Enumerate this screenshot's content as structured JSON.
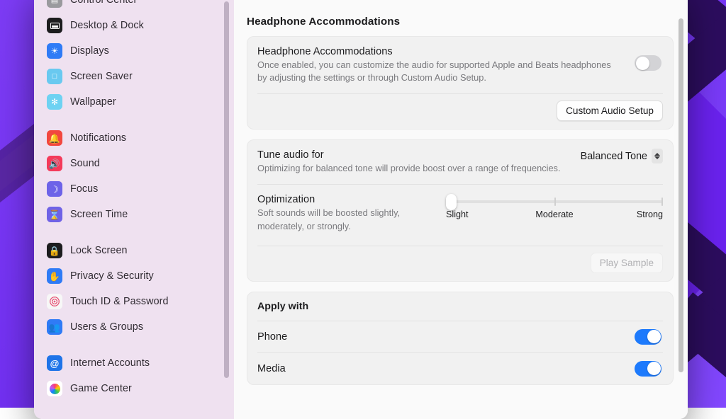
{
  "sidebar": {
    "items": [
      {
        "label": "Control Center",
        "icon": "control-center-icon",
        "color": "#9a9a9e",
        "glyph": "▤",
        "partial": true
      },
      {
        "label": "Desktop & Dock",
        "icon": "desktop-dock-icon",
        "color": "#1c1c1e",
        "glyph": "bar"
      },
      {
        "label": "Displays",
        "icon": "displays-icon",
        "color": "#2f7bf6",
        "glyph": "☀"
      },
      {
        "label": "Screen Saver",
        "icon": "screen-saver-icon",
        "color": "#69c9f0",
        "glyph": "□"
      },
      {
        "label": "Wallpaper",
        "icon": "wallpaper-icon",
        "color": "#6ed2f2",
        "glyph": "✻"
      },
      {
        "label": "__GAP__",
        "icon": "group-separator",
        "color": "",
        "glyph": ""
      },
      {
        "label": "Notifications",
        "icon": "notifications-icon",
        "color": "#f2473f",
        "glyph": "🔔"
      },
      {
        "label": "Sound",
        "icon": "sound-icon",
        "color": "#f43a5a",
        "glyph": "🔊"
      },
      {
        "label": "Focus",
        "icon": "focus-icon",
        "color": "#6d63e8",
        "glyph": "☽"
      },
      {
        "label": "Screen Time",
        "icon": "screen-time-icon",
        "color": "#6f62e6",
        "glyph": "⌛"
      },
      {
        "label": "__GAP__",
        "icon": "group-separator",
        "color": "",
        "glyph": ""
      },
      {
        "label": "Lock Screen",
        "icon": "lock-screen-icon",
        "color": "#1c1c1e",
        "glyph": "🔒"
      },
      {
        "label": "Privacy & Security",
        "icon": "privacy-security-icon",
        "color": "#2f7bf6",
        "glyph": "✋"
      },
      {
        "label": "Touch ID & Password",
        "icon": "touch-id-icon",
        "color": "#f7f7f7",
        "glyph": "๏"
      },
      {
        "label": "Users & Groups",
        "icon": "users-groups-icon",
        "color": "#2f7bf6",
        "glyph": "👥"
      },
      {
        "label": "__GAP__",
        "icon": "group-separator",
        "color": "",
        "glyph": ""
      },
      {
        "label": "Internet Accounts",
        "icon": "internet-accounts-icon",
        "color": "#1f74e8",
        "glyph": "@"
      },
      {
        "label": "Game Center",
        "icon": "game-center-icon",
        "color": "#ffffff",
        "glyph": "✿"
      }
    ]
  },
  "main": {
    "page_title": "Headphone Accommodations",
    "accommodations_card": {
      "title": "Headphone Accommodations",
      "description": "Once enabled, you can customize the audio for supported Apple and Beats headphones by adjusting the settings or through Custom Audio Setup.",
      "toggle_state": "off",
      "button_label": "Custom Audio Setup"
    },
    "tune_card": {
      "tune_title": "Tune audio for",
      "tune_description": "Optimizing for balanced tone will provide boost over a range of frequencies.",
      "tune_value": "Balanced Tone",
      "optimization_title": "Optimization",
      "optimization_description": "Soft sounds will be boosted slightly, moderately, or strongly.",
      "slider_labels": [
        "Slight",
        "Moderate",
        "Strong"
      ],
      "slider_value": "Slight",
      "play_button_label": "Play Sample",
      "play_button_state": "disabled"
    },
    "apply_card": {
      "title": "Apply with",
      "rows": [
        {
          "label": "Phone",
          "toggle_state": "on"
        },
        {
          "label": "Media",
          "toggle_state": "on"
        }
      ]
    }
  },
  "colors": {
    "accent_blue": "#1d7afc",
    "sidebar_bg": "#efe1f0",
    "card_bg": "#f1f1f1",
    "wallpaper_purple": "#7d3cf5"
  }
}
